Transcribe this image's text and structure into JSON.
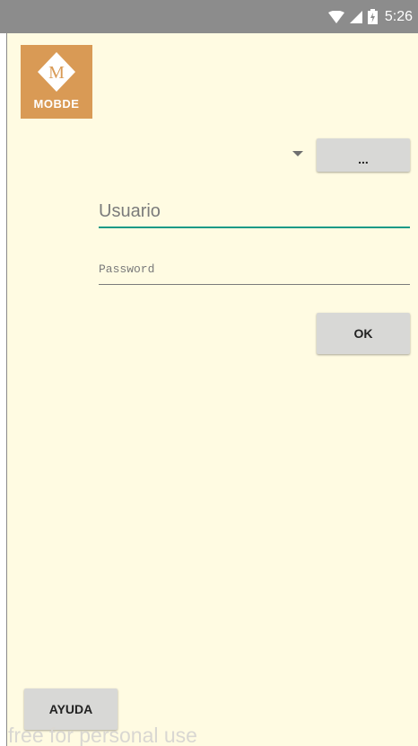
{
  "status_bar": {
    "time": "5:26",
    "icons": [
      "wifi-icon",
      "signal-icon",
      "battery-charging-icon"
    ]
  },
  "logo": {
    "letter": "M",
    "name": "MOBDE"
  },
  "login": {
    "more_button_label": "...",
    "username_placeholder": "Usuario",
    "password_placeholder": "Password",
    "ok_button_label": "OK"
  },
  "footer": {
    "help_button_label": "AYUDA",
    "watermark": "free for personal use"
  },
  "colors": {
    "background": "#fffbe2",
    "accent": "#1a9a86",
    "logo": "#d99a55",
    "status_bar": "#8c8c8c"
  }
}
